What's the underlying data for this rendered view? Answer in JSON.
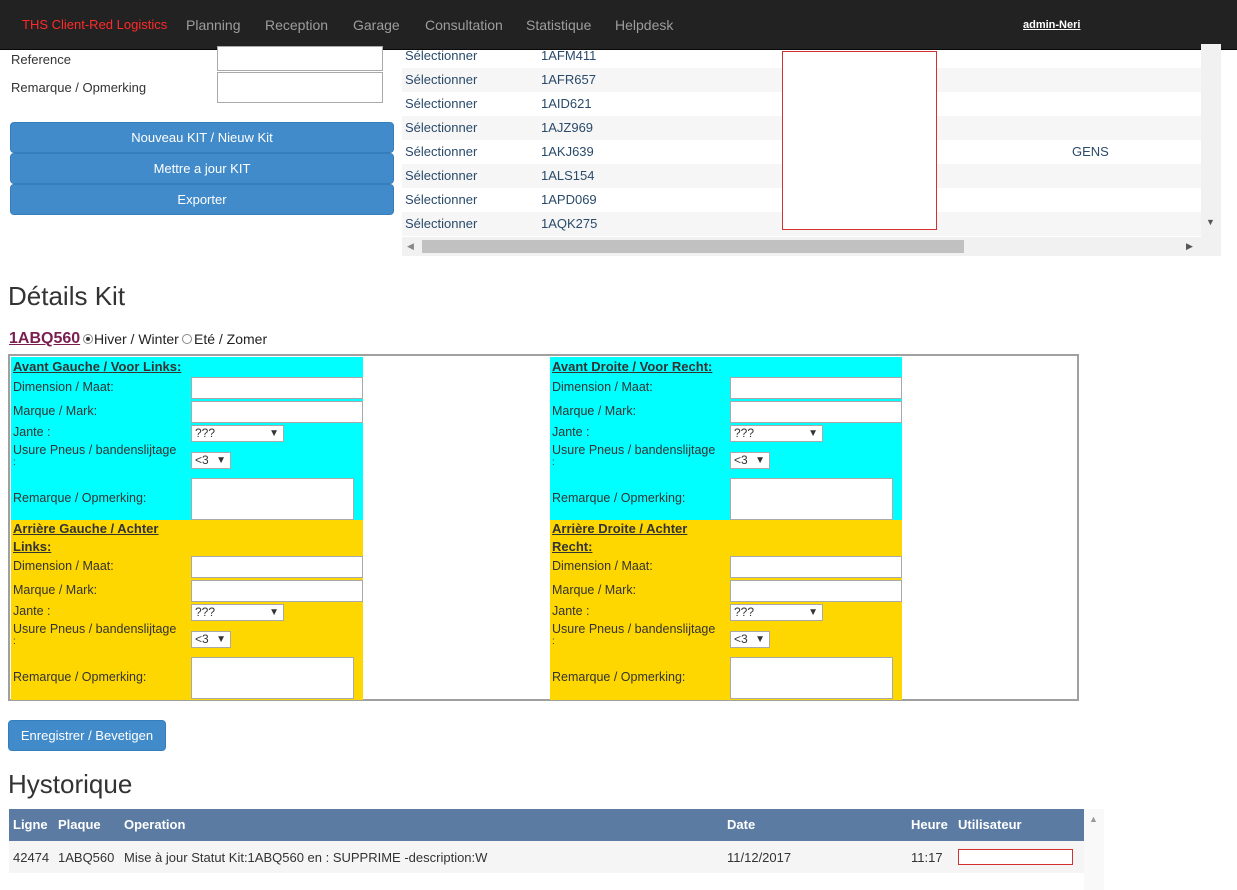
{
  "navbar": {
    "brand": "THS Client-Red Logistics",
    "items": [
      "Planning",
      "Reception",
      "Garage",
      "Consultation",
      "Statistique",
      "Helpdesk"
    ],
    "user": "admin-Neri"
  },
  "form": {
    "reference_label": "Reference",
    "remark_label": "Remarque / Opmerking",
    "buttons": {
      "new_kit": "Nouveau KIT / Nieuw Kit",
      "update_kit": "Mettre a jour KIT",
      "export": "Exporter"
    }
  },
  "vehicle_list": {
    "rows": [
      {
        "select": "Sélectionner",
        "plate": "1AFM411",
        "extra": ""
      },
      {
        "select": "Sélectionner",
        "plate": "1AFR657",
        "extra": ""
      },
      {
        "select": "Sélectionner",
        "plate": "1AID621",
        "extra": ""
      },
      {
        "select": "Sélectionner",
        "plate": "1AJZ969",
        "extra": ""
      },
      {
        "select": "Sélectionner",
        "plate": "1AKJ639",
        "extra": "GENS"
      },
      {
        "select": "Sélectionner",
        "plate": "1ALS154",
        "extra": ""
      },
      {
        "select": "Sélectionner",
        "plate": "1APD069",
        "extra": ""
      },
      {
        "select": "Sélectionner",
        "plate": "1AQK275",
        "extra": ""
      }
    ]
  },
  "details": {
    "title": "Détails Kit",
    "plate": "1ABQ560",
    "season_winter": "Hiver / Winter",
    "season_summer": "Eté / Zomer",
    "panels": {
      "front_left": {
        "title": "Avant Gauche / Voor Links:"
      },
      "front_right": {
        "title": "Avant Droite / Voor Recht:"
      },
      "rear_left": {
        "title_1": "Arrière Gauche / Achter",
        "title_2": "Links:"
      },
      "rear_right": {
        "title_1": "Arrière Droite / Achter",
        "title_2": "Recht:"
      }
    },
    "fields": {
      "dimension": "Dimension / Maat:",
      "brand": "Marque / Mark:",
      "rim": "Jante :",
      "wear": "Usure Pneus / bandenslijtage",
      "wear_colon": ":",
      "remark": "Remarque / Opmerking:"
    },
    "rim_value": "???",
    "wear_value": "<3",
    "save_button": "Enregistrer / Bevetigen"
  },
  "history": {
    "title": "Hystorique",
    "columns": {
      "line": "Ligne",
      "plate": "Plaque",
      "operation": "Operation",
      "date": "Date",
      "time": "Heure",
      "user": "Utilisateur"
    },
    "rows": [
      {
        "line": "42474",
        "plate": "1ABQ560",
        "operation": "Mise à jour Statut Kit:1ABQ560 en : SUPPRIME -description:W",
        "date": "11/12/2017",
        "time": "11:17"
      }
    ]
  },
  "colors": {
    "front_panel": "#00ffff",
    "rear_panel": "#ffd700",
    "header_bg": "#5b7ba3",
    "brand": "#ff2a2a"
  }
}
